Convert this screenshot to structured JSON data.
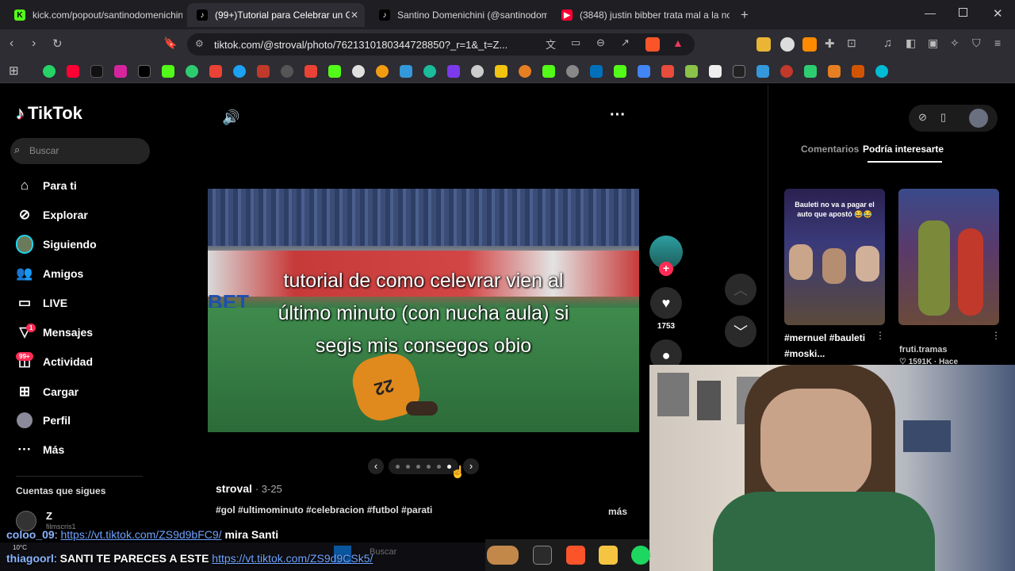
{
  "browser": {
    "tabs": [
      {
        "title": "kick.com/popout/santinodomenichini",
        "favicon": "K",
        "color": "#53fc18"
      },
      {
        "title": "(99+)Tutorial para Celebrar un G",
        "favicon": "♪",
        "color": "#000000"
      },
      {
        "title": "Santino Domenichini (@santinodom",
        "favicon": "♪",
        "color": "#000000"
      },
      {
        "title": "(3848) justin bibber trata mal a la no",
        "favicon": "▶",
        "color": "#ff0033"
      }
    ],
    "url": "tiktok.com/@stroval/photo/7621310180344728850?_r=1&_t=Z...",
    "new_tab": "+"
  },
  "tiktok": {
    "logo": "TikTok",
    "search_placeholder": "Buscar",
    "nav": [
      {
        "label": "Para ti",
        "icon": "home-icon"
      },
      {
        "label": "Explorar",
        "icon": "compass-icon"
      },
      {
        "label": "Siguiendo",
        "icon": "avatar-icon"
      },
      {
        "label": "Amigos",
        "icon": "friends-icon"
      },
      {
        "label": "LIVE",
        "icon": "live-icon"
      },
      {
        "label": "Mensajes",
        "icon": "messages-icon",
        "badge": "1"
      },
      {
        "label": "Actividad",
        "icon": "activity-icon",
        "badge": "99+"
      },
      {
        "label": "Cargar",
        "icon": "upload-icon"
      },
      {
        "label": "Perfil",
        "icon": "profile-icon"
      },
      {
        "label": "Más",
        "icon": "more-icon"
      }
    ],
    "following_heading": "Cuentas que sigues",
    "following_account": {
      "name": "Z",
      "handle": "filmscris1"
    },
    "post": {
      "caption_lines": [
        "tutorial de como celevrar vien al",
        "último minuto (con nucha aula) si",
        "segis mis consegos obio"
      ],
      "author": "stroval",
      "date": "· 3-25",
      "hashtags": "#gol #ultimominuto #celebracion #futbol #parati",
      "more": "más",
      "likes": "1753",
      "jersey_number": "22"
    },
    "right_panel": {
      "tabs": [
        "Comentarios",
        "Podría interesarte"
      ],
      "active_tab": "Podría interesarte",
      "suggestions": [
        {
          "overlay": "Bauleti no va a pagar el auto que apostó 😂😂",
          "title": "#mernuel #bauleti #moski...",
          "user": ""
        },
        {
          "overlay": "",
          "title": "",
          "user": "fruti.tramas",
          "likes": "♡ 1591K · Hace"
        }
      ]
    }
  },
  "overlay_chat": [
    {
      "user": "coloo_09",
      "link": "https://vt.tiktok.com/ZS9d9bFC9/",
      "text": "mira Santi"
    },
    {
      "user": "thiagoorl",
      "text": "SANTI TE PARECES A ESTE",
      "link": "https://vt.tiktok.com/ZS9d9CSk5/"
    }
  ],
  "taskbar": {
    "weather": "10°C",
    "search": "Buscar"
  }
}
